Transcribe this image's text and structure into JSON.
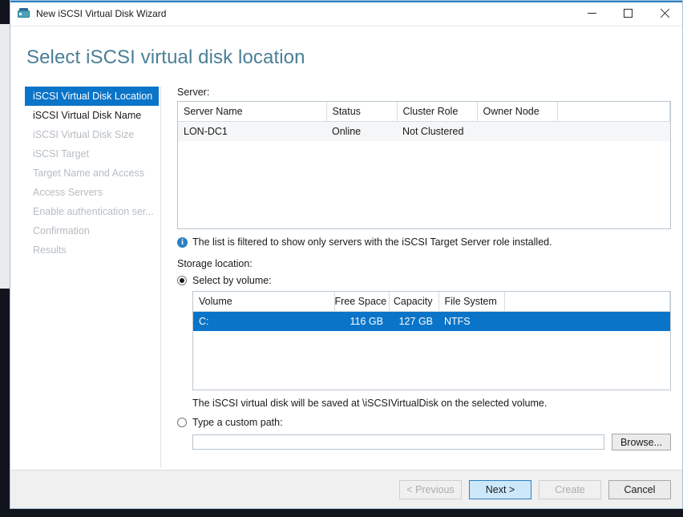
{
  "window": {
    "title": "New iSCSI Virtual Disk Wizard",
    "app_icon": "iscsi-disk-icon",
    "controls": {
      "minimize": "minimize-icon",
      "maximize": "maximize-icon",
      "close": "close-icon"
    }
  },
  "page": {
    "heading": "Select iSCSI virtual disk location",
    "accent_color": "#0a74c8",
    "heading_color": "#4a7f96"
  },
  "sidebar": {
    "items": [
      {
        "label": "iSCSI Virtual Disk Location",
        "state": "active"
      },
      {
        "label": "iSCSI Virtual Disk Name",
        "state": "enabled"
      },
      {
        "label": "iSCSI Virtual Disk Size",
        "state": "disabled"
      },
      {
        "label": "iSCSI Target",
        "state": "disabled"
      },
      {
        "label": "Target Name and Access",
        "state": "disabled"
      },
      {
        "label": "Access Servers",
        "state": "disabled"
      },
      {
        "label": "Enable authentication ser...",
        "state": "disabled"
      },
      {
        "label": "Confirmation",
        "state": "disabled"
      },
      {
        "label": "Results",
        "state": "disabled"
      }
    ]
  },
  "main": {
    "server_label": "Server:",
    "server_table": {
      "columns": [
        "Server Name",
        "Status",
        "Cluster Role",
        "Owner Node"
      ],
      "rows": [
        [
          "LON-DC1",
          "Online",
          "Not Clustered",
          ""
        ]
      ]
    },
    "info_icon": "info-icon",
    "info_text": "The list is filtered to show only servers with the iSCSI Target Server role installed.",
    "storage_label": "Storage location:",
    "radio_volume": {
      "label": "Select by volume:",
      "checked": true
    },
    "volume_table": {
      "columns": [
        "Volume",
        "Free Space",
        "Capacity",
        "File System"
      ],
      "rows": [
        {
          "cells": [
            "C:",
            "116 GB",
            "127 GB",
            "NTFS"
          ],
          "selected": true
        }
      ]
    },
    "save_hint": "The iSCSI virtual disk will be saved at \\iSCSIVirtualDisk on the selected volume.",
    "radio_custom": {
      "label": "Type a custom path:",
      "checked": false
    },
    "custom_path": {
      "value": "",
      "placeholder": ""
    },
    "browse_label": "Browse..."
  },
  "footer": {
    "previous_label": "< Previous",
    "next_label": "Next >",
    "create_label": "Create",
    "cancel_label": "Cancel"
  }
}
